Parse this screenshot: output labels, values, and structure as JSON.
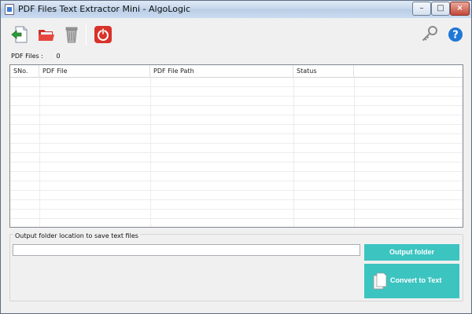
{
  "window": {
    "title": "PDF Files Text Extractor Mini - AlgoLogic"
  },
  "toolbar": {
    "icons": [
      "add-file-icon",
      "open-folder-icon",
      "trash-icon",
      "power-icon",
      "key-icon",
      "help-icon"
    ]
  },
  "files": {
    "label": "PDF Files :",
    "count": "0"
  },
  "grid": {
    "columns": [
      "SNo.",
      "PDF File",
      "PDF File Path",
      "Status"
    ],
    "rows": []
  },
  "output": {
    "group_label": "Output folder location to save text files",
    "path_value": "",
    "output_folder_label": "Output folder",
    "convert_label": "Convert to Text"
  },
  "colors": {
    "accent": "#3cc4c1",
    "help_blue": "#1e78d7",
    "power_red": "#d8322a"
  }
}
